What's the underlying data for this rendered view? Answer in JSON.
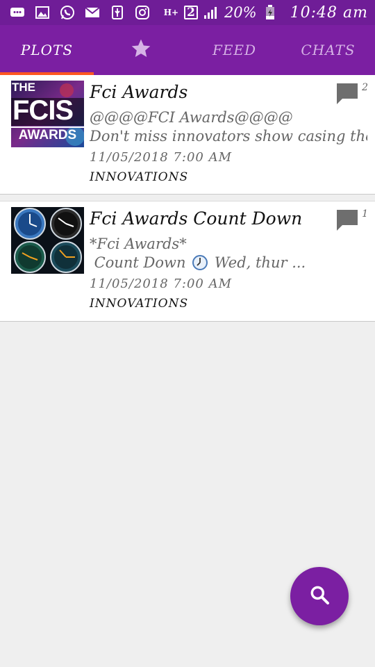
{
  "status_bar": {
    "network": "H+",
    "sim": "2",
    "battery": "20%",
    "time": "10:48 am",
    "icons": [
      "messages-icon",
      "gallery-icon",
      "whatsapp-icon",
      "email-icon",
      "usb-icon",
      "instagram-icon",
      "signal-icon",
      "battery-icon"
    ]
  },
  "tabs": [
    {
      "label": "PLOTS",
      "active": true
    },
    {
      "label": "",
      "icon": "star-icon",
      "active": false
    },
    {
      "label": "FEED",
      "active": false
    },
    {
      "label": "CHATS",
      "active": false
    }
  ],
  "posts": [
    {
      "title": "Fci Awards",
      "line1": "@@@@FCI Awards@@@@",
      "line2": "Don't miss innovators show casing their",
      "date": "11/05/2018 7:00 AM",
      "tag": "INNOVATIONS",
      "comments": "2",
      "thumb_text": {
        "top": "THE",
        "main": "FCIS",
        "bottom": "AWARDS"
      }
    },
    {
      "title": "Fci Awards Count Down",
      "line1": "*Fci Awards*",
      "line2_pre": " Count Down ",
      "line2_post": " Wed, thur ...",
      "date": "11/05/2018 7:00 AM",
      "tag": "INNOVATIONS",
      "comments": "1"
    }
  ],
  "fab": {
    "icon": "search-icon"
  },
  "colors": {
    "primary": "#7b1fa2",
    "status": "#6f1d97",
    "indicator": "#ff5722"
  }
}
